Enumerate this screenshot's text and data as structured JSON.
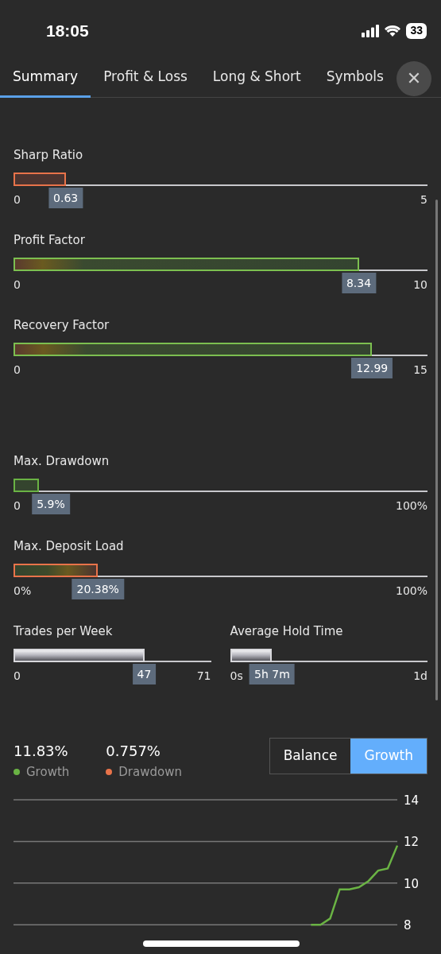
{
  "status_bar": {
    "time": "18:05",
    "battery": "33"
  },
  "tabs": [
    {
      "label": "Summary",
      "selected": true
    },
    {
      "label": "Profit & Loss",
      "selected": false
    },
    {
      "label": "Long & Short",
      "selected": false
    },
    {
      "label": "Symbols",
      "selected": false
    }
  ],
  "close_button": {
    "glyph": "✕"
  },
  "gauges": [
    {
      "label": "Sharp Ratio",
      "kind": "red",
      "level": 0.126,
      "value": "0.63",
      "min": "0",
      "max": "5"
    },
    {
      "label": "Profit Factor",
      "kind": "red-green",
      "level": 0.834,
      "value": "8.34",
      "min": "0",
      "max": "10"
    },
    {
      "label": "Recovery Factor",
      "kind": "red-green",
      "level": 0.866,
      "value": "12.99",
      "min": "0",
      "max": "15"
    },
    {
      "label": "Max. Drawdown",
      "kind": "green",
      "level": 0.059,
      "value": "5.9%",
      "min": "0",
      "max": "100%"
    },
    {
      "label": "Max. Deposit Load",
      "kind": "green-red",
      "level": 0.2038,
      "value": "20.38%",
      "min": "0%",
      "max": "100%"
    }
  ],
  "small_gauges": [
    {
      "label": "Trades per Week",
      "kind": "neutral",
      "level": 0.662,
      "value": "47",
      "min": "0",
      "max": "71"
    },
    {
      "label": "Average Hold Time",
      "kind": "neutral",
      "level": 0.213,
      "value": "5h 7m",
      "min": "0s",
      "max": "1d"
    }
  ],
  "legend": [
    {
      "value": "11.83%",
      "label": "Growth",
      "color": "#6ab344"
    },
    {
      "value": "0.757%",
      "label": "Drawdown",
      "color": "#e8734a"
    }
  ],
  "toggle": [
    {
      "label": "Balance",
      "selected": false
    },
    {
      "label": "Growth",
      "selected": true
    }
  ],
  "chart_data": {
    "type": "line",
    "ylim": [
      8,
      14
    ],
    "yticks": [
      8,
      10,
      12,
      14
    ],
    "values": [
      null,
      null,
      null,
      null,
      null,
      null,
      null,
      null,
      null,
      null,
      null,
      null,
      null,
      null,
      null,
      null,
      null,
      null,
      null,
      null,
      null,
      null,
      null,
      null,
      null,
      null,
      null,
      null,
      null,
      null,
      null,
      8,
      8,
      8.3,
      9.7,
      9.7,
      9.8,
      10.1,
      10.6,
      10.7,
      11.8
    ]
  }
}
